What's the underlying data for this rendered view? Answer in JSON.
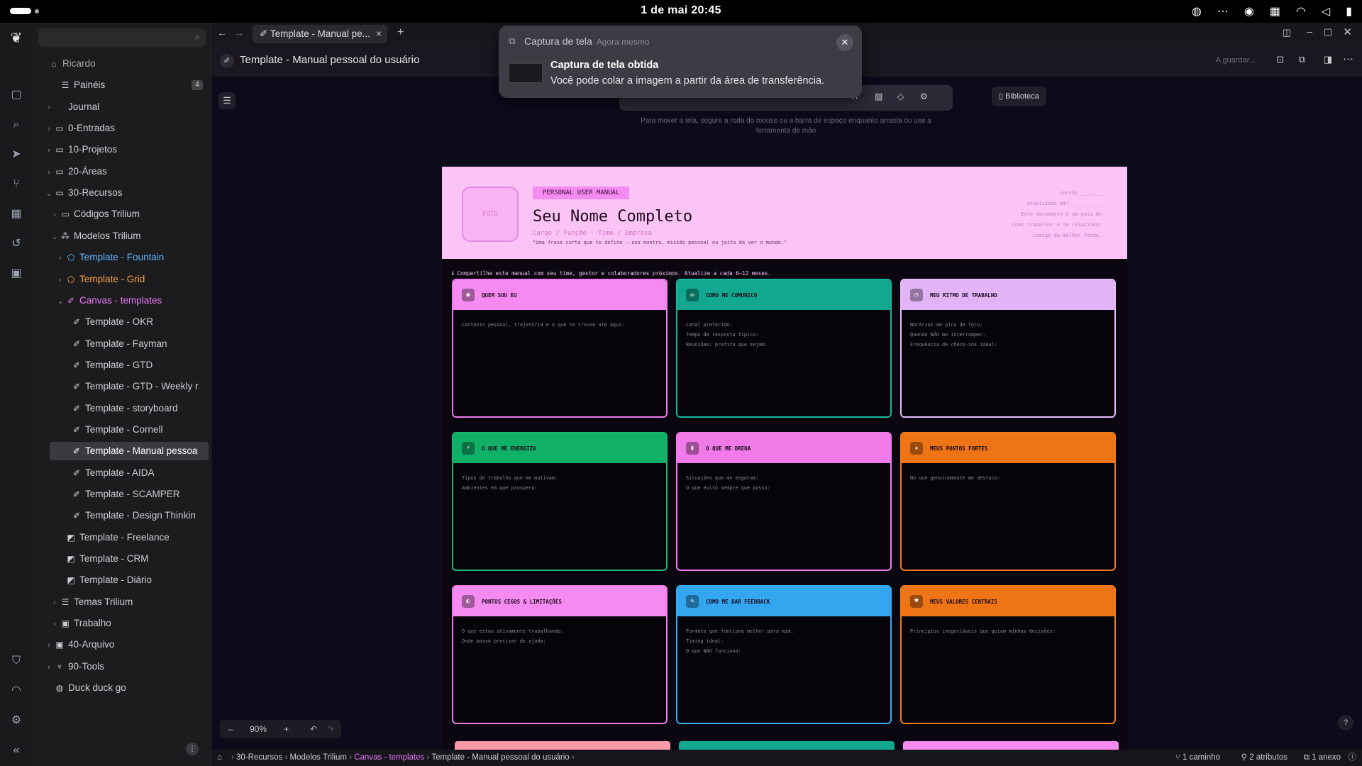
{
  "topbar": {
    "clock": "1 de mai  20:45"
  },
  "tree": {
    "items": [
      {
        "label": "Ricardo",
        "indent": 0,
        "chev": "",
        "icon": "⌂",
        "color": "#aaaaaa"
      },
      {
        "label": "Painéis",
        "indent": 2,
        "chev": "",
        "icon": "☰",
        "color": "#cfcfd4",
        "badge": "4"
      },
      {
        "label": "Journal",
        "indent": 1,
        "chev": "›",
        "icon": "",
        "color": "#cfcfd4"
      },
      {
        "label": "0-Entradas",
        "indent": 1,
        "chev": "›",
        "icon": "▭",
        "color": "#cfcfd4"
      },
      {
        "label": "10-Projetos",
        "indent": 1,
        "chev": "›",
        "icon": "▭",
        "color": "#cfcfd4"
      },
      {
        "label": "20-Áreas",
        "indent": 1,
        "chev": "›",
        "icon": "▭",
        "color": "#cfcfd4"
      },
      {
        "label": "30-Recursos",
        "indent": 1,
        "chev": "⌄",
        "icon": "▭",
        "color": "#cfcfd4"
      },
      {
        "label": "Códigos Trilium",
        "indent": 2,
        "chev": "›",
        "icon": "▭",
        "color": "#cfcfd4"
      },
      {
        "label": "Modelos Trilium",
        "indent": 2,
        "chev": "⌄",
        "icon": "⁂",
        "color": "#cfcfd4"
      },
      {
        "label": "Template - Fountain",
        "indent": 3,
        "chev": "›",
        "icon": "⬠",
        "color": "#60b4ff"
      },
      {
        "label": "Template - Grid",
        "indent": 3,
        "chev": "›",
        "icon": "⬠",
        "color": "#f5a044"
      },
      {
        "label": "Canvas - templates",
        "indent": 3,
        "chev": "⌄",
        "icon": "✐",
        "color": "#e879f9"
      },
      {
        "label": "Template - OKR",
        "indent": 4,
        "chev": "",
        "icon": "✐",
        "color": "#cfcfd4"
      },
      {
        "label": "Template - Fayman",
        "indent": 4,
        "chev": "",
        "icon": "✐",
        "color": "#cfcfd4"
      },
      {
        "label": "Template - GTD",
        "indent": 4,
        "chev": "",
        "icon": "✐",
        "color": "#cfcfd4"
      },
      {
        "label": "Template - GTD - Weekly r",
        "indent": 4,
        "chev": "",
        "icon": "✐",
        "color": "#cfcfd4"
      },
      {
        "label": "Template - storyboard",
        "indent": 4,
        "chev": "",
        "icon": "✐",
        "color": "#cfcfd4"
      },
      {
        "label": "Template - Cornell",
        "indent": 4,
        "chev": "",
        "icon": "✐",
        "color": "#cfcfd4"
      },
      {
        "label": "Template - Manual pessoa",
        "indent": 4,
        "chev": "",
        "icon": "✐",
        "color": "#ffffff",
        "selected": true
      },
      {
        "label": "Template - AIDA",
        "indent": 4,
        "chev": "",
        "icon": "✐",
        "color": "#cfcfd4"
      },
      {
        "label": "Template - SCAMPER",
        "indent": 4,
        "chev": "",
        "icon": "✐",
        "color": "#cfcfd4"
      },
      {
        "label": "Template - Design Thinkin",
        "indent": 4,
        "chev": "",
        "icon": "✐",
        "color": "#cfcfd4"
      },
      {
        "label": "Template - Freelance",
        "indent": 3,
        "chev": "",
        "icon": "◩",
        "color": "#cfcfd4"
      },
      {
        "label": "Template - CRM",
        "indent": 3,
        "chev": "",
        "icon": "◩",
        "color": "#cfcfd4"
      },
      {
        "label": "Template - Diário",
        "indent": 3,
        "chev": "",
        "icon": "◩",
        "color": "#cfcfd4"
      },
      {
        "label": "Temas Trilium",
        "indent": 2,
        "chev": "›",
        "icon": "☰",
        "color": "#cfcfd4"
      },
      {
        "label": "Trabalho",
        "indent": 2,
        "chev": "›",
        "icon": "▣",
        "color": "#cfcfd4"
      },
      {
        "label": "40-Arquivo",
        "indent": 1,
        "chev": "›",
        "icon": "▣",
        "color": "#cfcfd4"
      },
      {
        "label": "90-Tools",
        "indent": 1,
        "chev": "›",
        "icon": "♆",
        "color": "#cfcfd4"
      },
      {
        "label": "Duck duck go",
        "indent": 1,
        "chev": "",
        "icon": "◍",
        "color": "#cfcfd4"
      }
    ]
  },
  "tabs": {
    "active": "Template - Manual pe..."
  },
  "note": {
    "title": "Template - Manual pessoal do usuário",
    "saving": "A guardar..."
  },
  "canvas": {
    "hint": "Para mover a tela, segure a roda do mouse ou a barra de espaço enquanto arrasta ou use a ferramenta de mão",
    "library": "Biblioteca",
    "zoom": "90%"
  },
  "manual": {
    "foto": "FOTO",
    "tag": "PERSONAL USER MANUAL",
    "name": "Seu Nome Completo",
    "role": "Cargo / Função  ·  Time / Empresa",
    "quote": "\"Uma frase curta que te define — seu mantra, missão pessoal ou jeito de ver o mundo.\"",
    "meta": [
      "versão  ___.___",
      "atualizado em: __________",
      "Este documento é um guia de",
      "como trabalhar e se relacionar",
      "comigo da melhor forma."
    ],
    "share": "ℹ  Compartilhe este manual com seu time, gestor e colaboradores próximos. Atualize a cada 6–12 meses.",
    "cards": [
      {
        "title": "QUEM SOU EU",
        "head": "#f58bf0",
        "border": "#f07ae8",
        "icon": "◉",
        "lines": [
          "Contexto pessoal, trajetória e o que te trouxe até aqui:"
        ]
      },
      {
        "title": "COMO ME COMUNICO",
        "head": "#11a88f",
        "border": "#14b89c",
        "icon": "✉",
        "lines": [
          "Canal preferido:",
          "Tempo de resposta típico:",
          "Reuniões: prefiro que sejam:"
        ]
      },
      {
        "title": "MEU RITMO DE TRABALHO",
        "head": "#e3b3f8",
        "border": "#e7bdfa",
        "icon": "◷",
        "lines": [
          "Horários de pico de foco:",
          "Quando NÃO me interromper:",
          "Frequência de check-ins ideal:"
        ]
      },
      {
        "title": "O QUE ME ENERGIZA",
        "head": "#10b067",
        "border": "#12b870",
        "icon": "⚡",
        "lines": [
          "Tipos de trabalho que me motivam:",
          "Ambientes em que prospero:"
        ]
      },
      {
        "title": "O QUE ME DRENA",
        "head": "#f07ae8",
        "border": "#f07ae8",
        "icon": "▮",
        "lines": [
          "Situações que me esgotam:",
          "O que evito sempre que posso:"
        ]
      },
      {
        "title": "MEUS PONTOS FORTES",
        "head": "#ee7416",
        "border": "#f07a1a",
        "icon": "★",
        "lines": [
          "No que genuinamente me destaco:"
        ]
      },
      {
        "title": "PONTOS CEGOS & LIMITAÇÕES",
        "head": "#f58bf0",
        "border": "#f07ae8",
        "icon": "◐",
        "lines": [
          "O que estou ativamente trabalhando:",
          "Onde posso precisar de ajuda:"
        ]
      },
      {
        "title": "COMO ME DAR FEEDBACK",
        "head": "#33a6ef",
        "border": "#36aaf2",
        "icon": "✎",
        "lines": [
          "Formato que funciona melhor para mim:",
          "Timing ideal:",
          "O que NÃO funciona:"
        ]
      },
      {
        "title": "MEUS VALORES CENTRAIS",
        "head": "#ee7416",
        "border": "#f07a1a",
        "icon": "♥",
        "lines": [
          "Princípios inegociáveis que guiam minhas decisões:"
        ]
      }
    ]
  },
  "toast": {
    "app": "Captura de tela",
    "ago": "Agora mesmo",
    "title": "Captura de tela obtida",
    "body": "Você pode colar a imagem a partir da área de transferência."
  },
  "status": {
    "crumbs": [
      "30-Recursos",
      "Modelos Trilium",
      "Canvas - templates",
      "Template - Manual pessoal do usuário"
    ],
    "paths": "1 caminho",
    "attrs": "2 atributos",
    "attach": "1 anexo"
  }
}
